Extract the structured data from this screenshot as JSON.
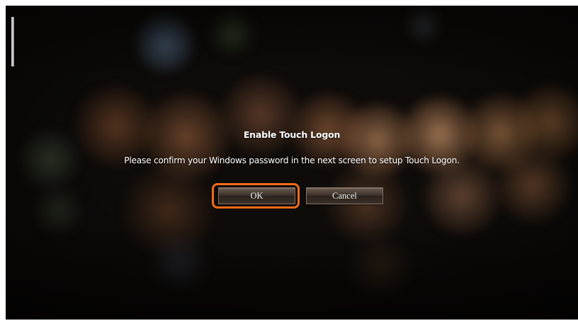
{
  "dialog": {
    "title": "Enable Touch Logon",
    "message": "Please confirm your Windows password in the next screen to setup Touch Logon.",
    "ok_label": "OK",
    "cancel_label": "Cancel"
  },
  "colors": {
    "highlight": "#f06a18",
    "background": "#0e0b09",
    "text": "#ffffff"
  }
}
